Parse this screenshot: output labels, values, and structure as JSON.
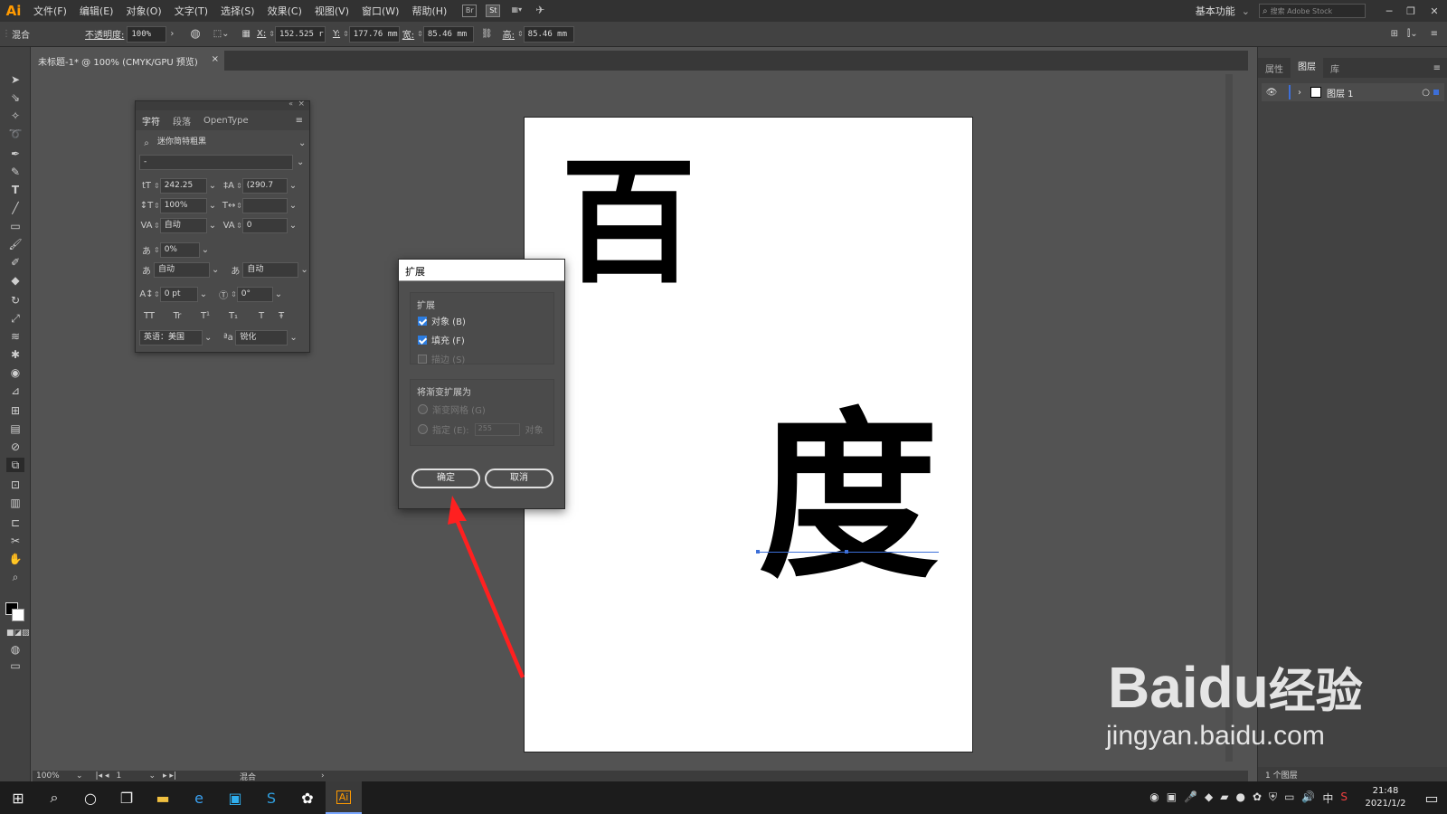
{
  "menubar": {
    "logo": "Ai",
    "items": [
      "文件(F)",
      "编辑(E)",
      "对象(O)",
      "文字(T)",
      "选择(S)",
      "效果(C)",
      "视图(V)",
      "窗口(W)",
      "帮助(H)"
    ],
    "br_label": "Br",
    "st_label": "St",
    "workspace": "基本功能",
    "stock_search_placeholder": "搜索 Adobe Stock"
  },
  "controlbar": {
    "mode": "混合",
    "opacity_label": "不透明度:",
    "opacity_value": "100%",
    "x_label": "X:",
    "x_value": "152.525 r",
    "y_label": "Y:",
    "y_value": "177.76 mm",
    "w_label": "宽:",
    "w_value": "85.46 mm",
    "h_label": "高:",
    "h_value": "85.46 mm"
  },
  "document": {
    "tab_title": "未标题-1* @ 100% (CMYK/GPU 预览)"
  },
  "artboard": {
    "char1": "百",
    "char2": "度"
  },
  "character_panel": {
    "tabs": [
      "字符",
      "段落",
      "OpenType"
    ],
    "font_family": "迷你简特粗黑",
    "font_style": "-",
    "font_size": "242.25",
    "leading": "(290.7",
    "vertical_scale": "100%",
    "horizontal_scale": "",
    "kerning": "自动",
    "tracking": "0",
    "tsume": "0%",
    "aki_left": "自动",
    "aki_right": "自动",
    "baseline_shift": "0 pt",
    "rotation": "0°",
    "text_buttons": [
      "TT",
      "Tr",
      "T¹",
      "T₁",
      "T",
      "Ŧ"
    ],
    "language": "英语：美国",
    "antialias_icon_label": "ªa",
    "antialias": "锐化"
  },
  "expand_dialog": {
    "title": "扩展",
    "group1_label": "扩展",
    "object_label": "对象 (B)",
    "fill_label": "填充 (F)",
    "stroke_label": "描边 (S)",
    "group2_label": "将渐变扩展为",
    "gradient_mesh_label": "渐变网格 (G)",
    "specify_label": "指定 (E):",
    "specify_value": "255",
    "objects_unit": "对象",
    "ok_label": "确定",
    "cancel_label": "取消"
  },
  "layers_panel": {
    "tabs": [
      "属性",
      "图层",
      "库"
    ],
    "layer_name": "图层 1",
    "footer": "1 个图层"
  },
  "statusbar": {
    "zoom": "100%",
    "artboard_num": "1",
    "mode": "混合"
  },
  "taskbar": {
    "time": "21:48",
    "date": "2021/1/2",
    "ime": "中",
    "ai_label": "Ai"
  },
  "watermark": {
    "brand": "Bai",
    "du": "du",
    "jingyan": "经验",
    "url": "jingyan.baidu.com"
  },
  "colors": {
    "annotation_arrow": "#ff2020",
    "selection": "#3d6fd8",
    "checkbox": "#2d7de0"
  }
}
